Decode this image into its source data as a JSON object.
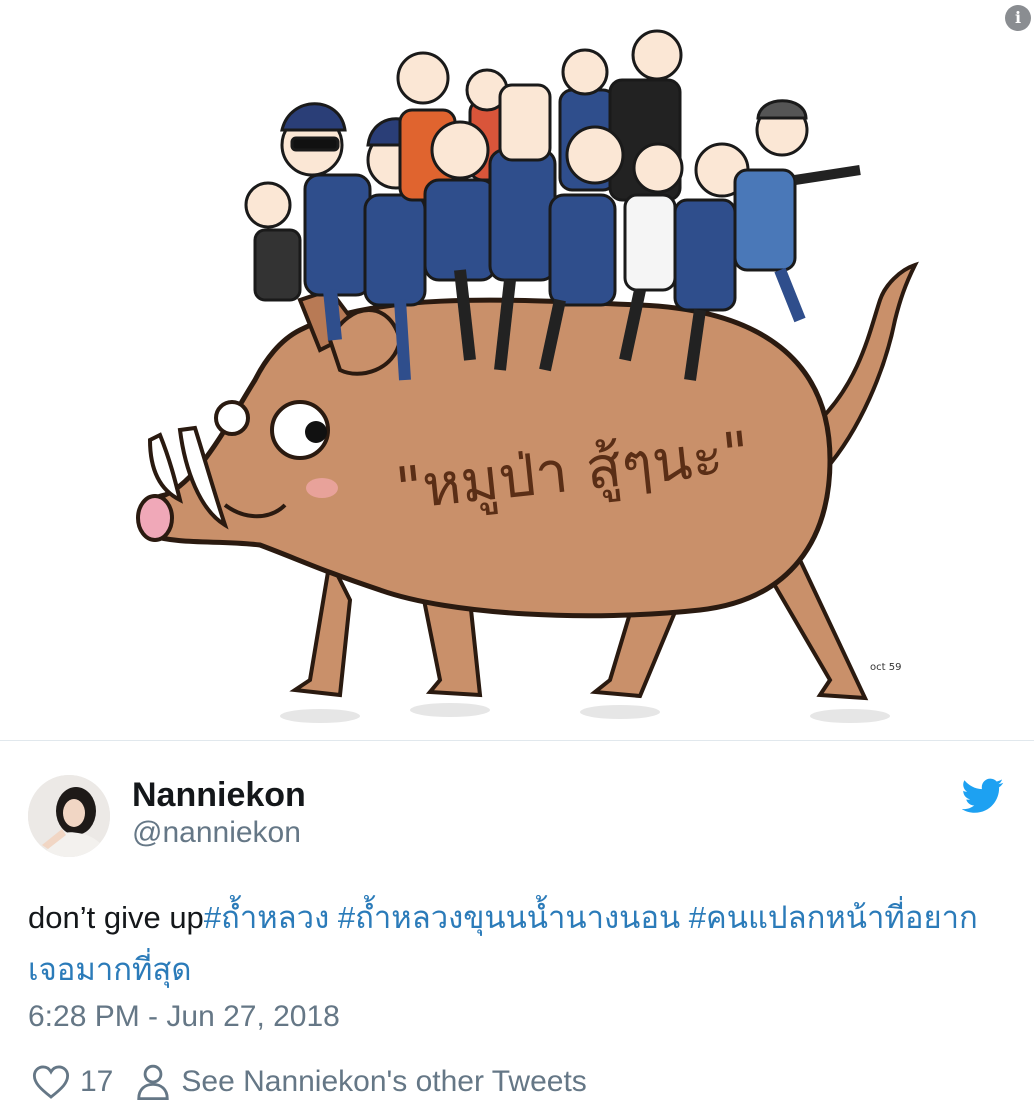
{
  "media": {
    "caption_art_text": "\"หมูป่า สู้ๆนะ\"",
    "signature_text": "oct 59"
  },
  "tweet": {
    "display_name": "Nanniekon",
    "handle": "@nanniekon",
    "text_plain": "don’t give up",
    "hashtags": [
      "#ถ้ำหลวง",
      "#ถ้ำหลวงขุนนน้ำนางนอน",
      "#คนแปลกหน้าที่อยากเจอมากที่สุด"
    ],
    "timestamp": "6:28 PM - Jun 27, 2018",
    "like_count": "17",
    "see_other_tweets": "See Nanniekon's other Tweets"
  },
  "icons": {
    "info": "info-icon",
    "bird": "twitter-bird-icon",
    "heart": "heart-icon",
    "person": "person-icon"
  },
  "colors": {
    "link": "#2b7bb9",
    "secondary_text": "#657786",
    "twitter_blue": "#1da1f2",
    "boar": "#c9906a"
  }
}
